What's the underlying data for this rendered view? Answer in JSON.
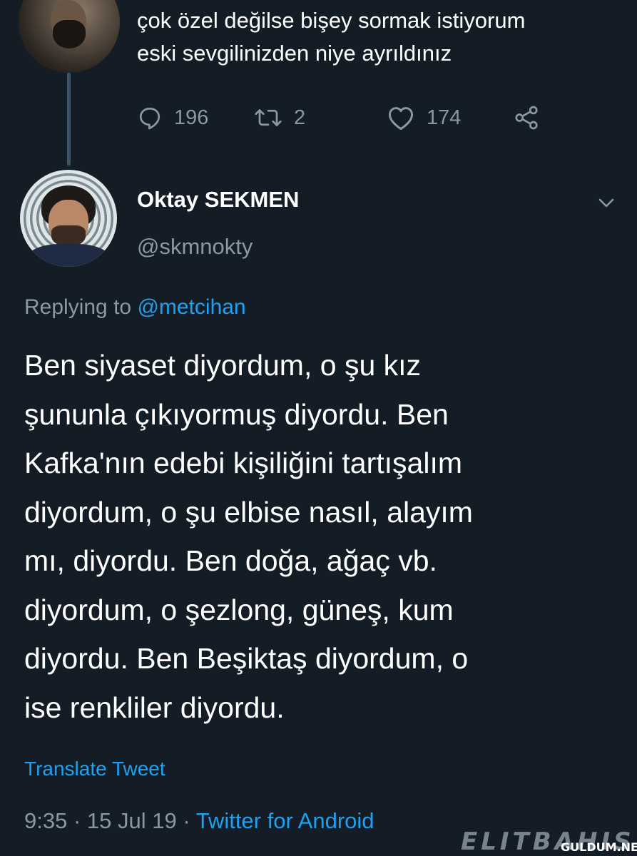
{
  "parent_tweet": {
    "lines": [
      "çok özel değilse bişey sormak istiyorum",
      "eski sevgilinizden niye ayrıldınız"
    ],
    "actions": {
      "reply_count": "196",
      "retweet_count": "2",
      "like_count": "174"
    }
  },
  "reply_tweet": {
    "display_name": "Oktay SEKMEN",
    "handle": "@skmnokty",
    "replying_prefix": "Replying to ",
    "replying_mention": "@metcihan",
    "body_lines": [
      "Ben siyaset diyordum, o şu kız",
      "şununla çıkıyormuş diyordu. Ben",
      "Kafka'nın edebi kişiliğini tartışalım",
      "diyordum, o şu elbise nasıl, alayım",
      "mı, diyordu. Ben doğa, ağaç vb.",
      "diyordum, o şezlong, güneş, kum",
      "diyordu. Ben Beşiktaş diyordum, o",
      "ise renkliler diyordu."
    ],
    "translate_label": "Translate Tweet",
    "timestamp": "9:35 · 15 Jul 19 · ",
    "source": "Twitter for Android"
  },
  "watermark": {
    "brand": "ELITBAHIS",
    "site": "GULDUM.NET"
  },
  "icons": {
    "reply": "speech-bubble-icon",
    "retweet": "retweet-arrows-icon",
    "like": "heart-icon",
    "share": "share-icon",
    "menu": "chevron-down-icon"
  },
  "colors": {
    "background": "#141d26",
    "text_primary": "#ffffff",
    "text_secondary": "#8899a6",
    "link": "#1da1f2"
  }
}
